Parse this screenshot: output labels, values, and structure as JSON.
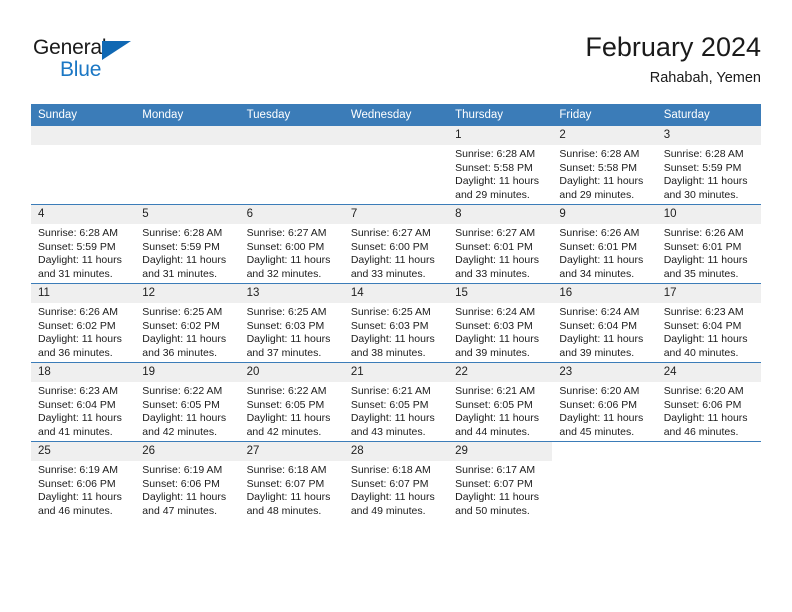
{
  "brand": {
    "name_part1": "General",
    "name_part2": "Blue",
    "triangle_color": "#1068b3",
    "blue_color": "#1b77c4"
  },
  "header": {
    "title": "February 2024",
    "subtitle": "Rahabah, Yemen",
    "accent_color": "#3b7cb8",
    "daynum_band_color": "#efefef"
  },
  "weekdays": [
    "Sunday",
    "Monday",
    "Tuesday",
    "Wednesday",
    "Thursday",
    "Friday",
    "Saturday"
  ],
  "labels": {
    "sunrise_prefix": "Sunrise:",
    "sunset_prefix": "Sunset:",
    "daylight_prefix": "Daylight:"
  },
  "weeks": [
    [
      {
        "day": "",
        "empty": true
      },
      {
        "day": "",
        "empty": true
      },
      {
        "day": "",
        "empty": true
      },
      {
        "day": "",
        "empty": true
      },
      {
        "day": "1",
        "sunrise": "Sunrise: 6:28 AM",
        "sunset": "Sunset: 5:58 PM",
        "daylight_l1": "Daylight: 11 hours",
        "daylight_l2": "and 29 minutes."
      },
      {
        "day": "2",
        "sunrise": "Sunrise: 6:28 AM",
        "sunset": "Sunset: 5:58 PM",
        "daylight_l1": "Daylight: 11 hours",
        "daylight_l2": "and 29 minutes."
      },
      {
        "day": "3",
        "sunrise": "Sunrise: 6:28 AM",
        "sunset": "Sunset: 5:59 PM",
        "daylight_l1": "Daylight: 11 hours",
        "daylight_l2": "and 30 minutes."
      }
    ],
    [
      {
        "day": "4",
        "sunrise": "Sunrise: 6:28 AM",
        "sunset": "Sunset: 5:59 PM",
        "daylight_l1": "Daylight: 11 hours",
        "daylight_l2": "and 31 minutes."
      },
      {
        "day": "5",
        "sunrise": "Sunrise: 6:28 AM",
        "sunset": "Sunset: 5:59 PM",
        "daylight_l1": "Daylight: 11 hours",
        "daylight_l2": "and 31 minutes."
      },
      {
        "day": "6",
        "sunrise": "Sunrise: 6:27 AM",
        "sunset": "Sunset: 6:00 PM",
        "daylight_l1": "Daylight: 11 hours",
        "daylight_l2": "and 32 minutes."
      },
      {
        "day": "7",
        "sunrise": "Sunrise: 6:27 AM",
        "sunset": "Sunset: 6:00 PM",
        "daylight_l1": "Daylight: 11 hours",
        "daylight_l2": "and 33 minutes."
      },
      {
        "day": "8",
        "sunrise": "Sunrise: 6:27 AM",
        "sunset": "Sunset: 6:01 PM",
        "daylight_l1": "Daylight: 11 hours",
        "daylight_l2": "and 33 minutes."
      },
      {
        "day": "9",
        "sunrise": "Sunrise: 6:26 AM",
        "sunset": "Sunset: 6:01 PM",
        "daylight_l1": "Daylight: 11 hours",
        "daylight_l2": "and 34 minutes."
      },
      {
        "day": "10",
        "sunrise": "Sunrise: 6:26 AM",
        "sunset": "Sunset: 6:01 PM",
        "daylight_l1": "Daylight: 11 hours",
        "daylight_l2": "and 35 minutes."
      }
    ],
    [
      {
        "day": "11",
        "sunrise": "Sunrise: 6:26 AM",
        "sunset": "Sunset: 6:02 PM",
        "daylight_l1": "Daylight: 11 hours",
        "daylight_l2": "and 36 minutes."
      },
      {
        "day": "12",
        "sunrise": "Sunrise: 6:25 AM",
        "sunset": "Sunset: 6:02 PM",
        "daylight_l1": "Daylight: 11 hours",
        "daylight_l2": "and 36 minutes."
      },
      {
        "day": "13",
        "sunrise": "Sunrise: 6:25 AM",
        "sunset": "Sunset: 6:03 PM",
        "daylight_l1": "Daylight: 11 hours",
        "daylight_l2": "and 37 minutes."
      },
      {
        "day": "14",
        "sunrise": "Sunrise: 6:25 AM",
        "sunset": "Sunset: 6:03 PM",
        "daylight_l1": "Daylight: 11 hours",
        "daylight_l2": "and 38 minutes."
      },
      {
        "day": "15",
        "sunrise": "Sunrise: 6:24 AM",
        "sunset": "Sunset: 6:03 PM",
        "daylight_l1": "Daylight: 11 hours",
        "daylight_l2": "and 39 minutes."
      },
      {
        "day": "16",
        "sunrise": "Sunrise: 6:24 AM",
        "sunset": "Sunset: 6:04 PM",
        "daylight_l1": "Daylight: 11 hours",
        "daylight_l2": "and 39 minutes."
      },
      {
        "day": "17",
        "sunrise": "Sunrise: 6:23 AM",
        "sunset": "Sunset: 6:04 PM",
        "daylight_l1": "Daylight: 11 hours",
        "daylight_l2": "and 40 minutes."
      }
    ],
    [
      {
        "day": "18",
        "sunrise": "Sunrise: 6:23 AM",
        "sunset": "Sunset: 6:04 PM",
        "daylight_l1": "Daylight: 11 hours",
        "daylight_l2": "and 41 minutes."
      },
      {
        "day": "19",
        "sunrise": "Sunrise: 6:22 AM",
        "sunset": "Sunset: 6:05 PM",
        "daylight_l1": "Daylight: 11 hours",
        "daylight_l2": "and 42 minutes."
      },
      {
        "day": "20",
        "sunrise": "Sunrise: 6:22 AM",
        "sunset": "Sunset: 6:05 PM",
        "daylight_l1": "Daylight: 11 hours",
        "daylight_l2": "and 42 minutes."
      },
      {
        "day": "21",
        "sunrise": "Sunrise: 6:21 AM",
        "sunset": "Sunset: 6:05 PM",
        "daylight_l1": "Daylight: 11 hours",
        "daylight_l2": "and 43 minutes."
      },
      {
        "day": "22",
        "sunrise": "Sunrise: 6:21 AM",
        "sunset": "Sunset: 6:05 PM",
        "daylight_l1": "Daylight: 11 hours",
        "daylight_l2": "and 44 minutes."
      },
      {
        "day": "23",
        "sunrise": "Sunrise: 6:20 AM",
        "sunset": "Sunset: 6:06 PM",
        "daylight_l1": "Daylight: 11 hours",
        "daylight_l2": "and 45 minutes."
      },
      {
        "day": "24",
        "sunrise": "Sunrise: 6:20 AM",
        "sunset": "Sunset: 6:06 PM",
        "daylight_l1": "Daylight: 11 hours",
        "daylight_l2": "and 46 minutes."
      }
    ],
    [
      {
        "day": "25",
        "sunrise": "Sunrise: 6:19 AM",
        "sunset": "Sunset: 6:06 PM",
        "daylight_l1": "Daylight: 11 hours",
        "daylight_l2": "and 46 minutes."
      },
      {
        "day": "26",
        "sunrise": "Sunrise: 6:19 AM",
        "sunset": "Sunset: 6:06 PM",
        "daylight_l1": "Daylight: 11 hours",
        "daylight_l2": "and 47 minutes."
      },
      {
        "day": "27",
        "sunrise": "Sunrise: 6:18 AM",
        "sunset": "Sunset: 6:07 PM",
        "daylight_l1": "Daylight: 11 hours",
        "daylight_l2": "and 48 minutes."
      },
      {
        "day": "28",
        "sunrise": "Sunrise: 6:18 AM",
        "sunset": "Sunset: 6:07 PM",
        "daylight_l1": "Daylight: 11 hours",
        "daylight_l2": "and 49 minutes."
      },
      {
        "day": "29",
        "sunrise": "Sunrise: 6:17 AM",
        "sunset": "Sunset: 6:07 PM",
        "daylight_l1": "Daylight: 11 hours",
        "daylight_l2": "and 50 minutes."
      },
      {
        "day": "",
        "blank": true
      },
      {
        "day": "",
        "blank": true
      }
    ]
  ]
}
